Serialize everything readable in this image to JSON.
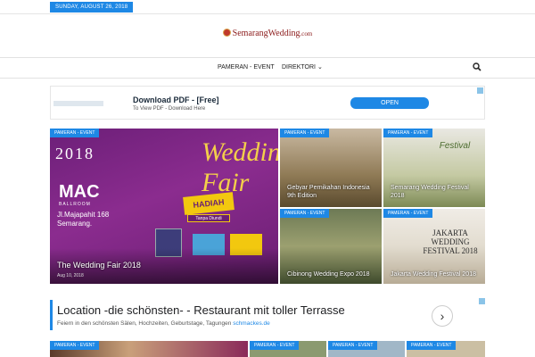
{
  "header": {
    "date": "SUNDAY, AUGUST 26, 2018",
    "logo_text": "SemarangWedding",
    "logo_domain": ".com"
  },
  "nav": {
    "items": [
      {
        "label": "PAMERAN - EVENT"
      },
      {
        "label": "DIREKTORI"
      }
    ],
    "search_icon": "search-icon"
  },
  "ad_top": {
    "title": "Download PDF - [Free]",
    "subtitle": "To View PDF - Download Here",
    "button": "OPEN"
  },
  "featured": {
    "big": {
      "category": "PAMERAN - EVENT",
      "year": "2018",
      "script": "Wedding Fair",
      "brand": "MAC",
      "brand_sub": "BALLROOM",
      "address_line1": "Jl.Majapahit 168",
      "address_line2": "Semarang.",
      "promo": "HADIAH",
      "promo_sub": "Tanpa Diundi",
      "title": "The Wedding Fair 2018",
      "date": "Aug 10, 2018"
    },
    "tiles": [
      {
        "category": "PAMERAN - EVENT",
        "title": "Gebyar Pernikahan Indonesia 9th Edition"
      },
      {
        "category": "PAMERAN - EVENT",
        "title": "Semarang Wedding Festival 2018",
        "badge": "Festival"
      },
      {
        "category": "PAMERAN - EVENT",
        "title": "Cibinong Wedding Expo 2018"
      },
      {
        "category": "PAMERAN - EVENT",
        "title": "Jakarta Wedding Festival 2018",
        "poster": "JAKARTA WEDDING FESTIVAL 2018"
      }
    ]
  },
  "ad_bottom": {
    "headline": "Location -die schönsten- - Restaurant mit toller Terrasse",
    "sub": "Feiern in den schönsten Sälen, Hochzeiten, Geburtstage, Tagungen",
    "domain": "schmackes.de",
    "arrow": "›"
  },
  "bottom_row": [
    {
      "category": "PAMERAN - EVENT"
    },
    {
      "category": "PAMERAN - EVENT"
    },
    {
      "category": "PAMERAN - EVENT"
    },
    {
      "category": "PAMERAN - EVENT"
    }
  ]
}
